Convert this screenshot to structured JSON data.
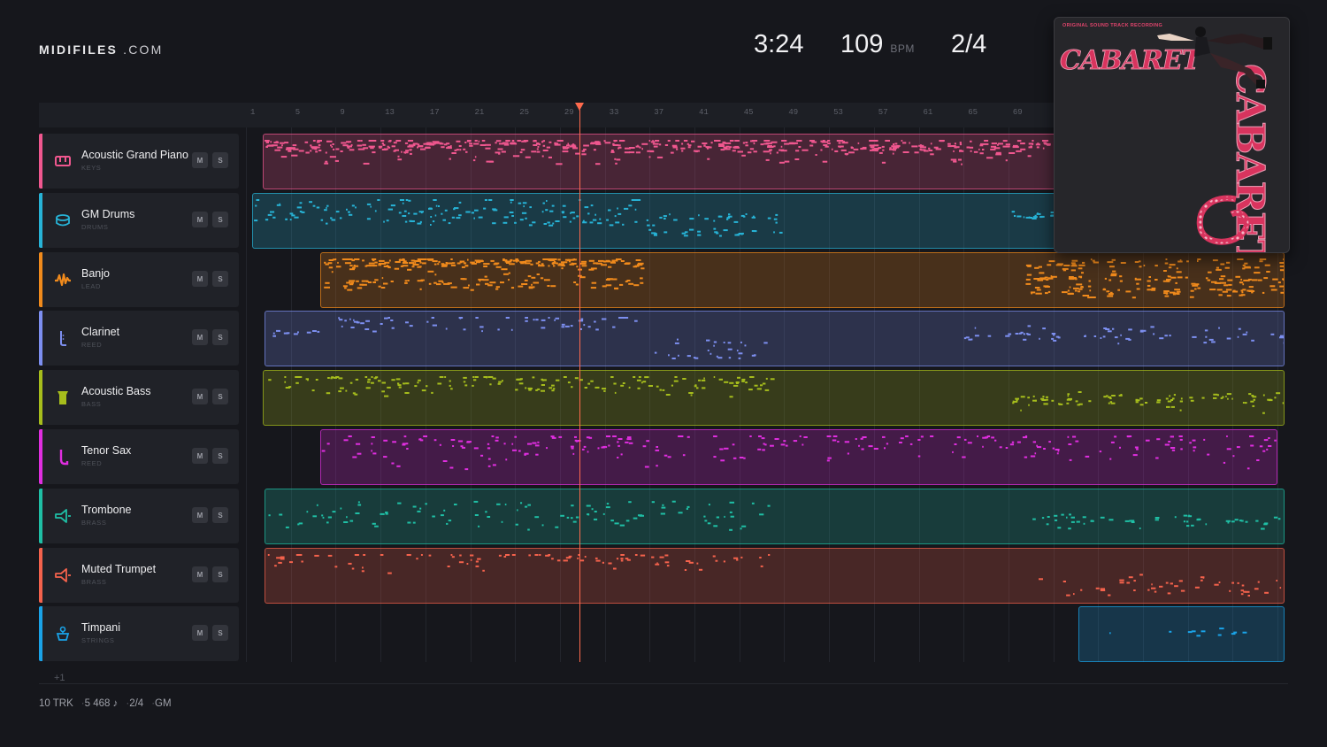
{
  "brand": {
    "name_bold": "MIDIFILES",
    "name_rest": " .COM"
  },
  "transport": {
    "time": "3:24",
    "tempo": "109",
    "tempo_unit": "BPM",
    "signature": "2/4"
  },
  "ruler": {
    "ticks": [
      "1",
      "5",
      "9",
      "13",
      "17",
      "21",
      "25",
      "29",
      "33",
      "37",
      "41",
      "45",
      "49",
      "53",
      "57",
      "61",
      "65",
      "69"
    ]
  },
  "tracks": [
    {
      "name": "Acoustic Grand Piano",
      "category": "KEYS",
      "icon": "piano-icon",
      "color": "#f0578f",
      "mute": "M",
      "solo": "S"
    },
    {
      "name": "GM Drums",
      "category": "DRUMS",
      "icon": "drum-icon",
      "color": "#27b3d6",
      "mute": "M",
      "solo": "S"
    },
    {
      "name": "Banjo",
      "category": "LEAD",
      "icon": "waveform-icon",
      "color": "#f08a1c",
      "mute": "M",
      "solo": "S"
    },
    {
      "name": "Clarinet",
      "category": "REED",
      "icon": "clarinet-icon",
      "color": "#7d8ff0",
      "mute": "M",
      "solo": "S"
    },
    {
      "name": "Acoustic Bass",
      "category": "BASS",
      "icon": "bass-icon",
      "color": "#a6bd1c",
      "mute": "M",
      "solo": "S"
    },
    {
      "name": "Tenor Sax",
      "category": "REED",
      "icon": "sax-icon",
      "color": "#e02ee0",
      "mute": "M",
      "solo": "S"
    },
    {
      "name": "Trombone",
      "category": "BRASS",
      "icon": "trombone-icon",
      "color": "#1fbfa5",
      "mute": "M",
      "solo": "S"
    },
    {
      "name": "Muted Trumpet",
      "category": "BRASS",
      "icon": "trumpet-icon",
      "color": "#f4624c",
      "mute": "M",
      "solo": "S"
    },
    {
      "name": "Timpani",
      "category": "STRINGS",
      "icon": "timpani-icon",
      "color": "#1aa3e8",
      "mute": "M",
      "solo": "S"
    }
  ],
  "playhead": {
    "bar": 30
  },
  "cover": {
    "caption": "ORIGINAL SOUND TRACK RECORDING",
    "title": "CABARET"
  },
  "add_track": "+1",
  "status": {
    "tracks": "10 TRK",
    "notes": "5 468 ♪",
    "signature": "2/4",
    "standard": "GM"
  },
  "colors": {
    "background": "#16171c",
    "playhead": "#ff6a4d"
  }
}
